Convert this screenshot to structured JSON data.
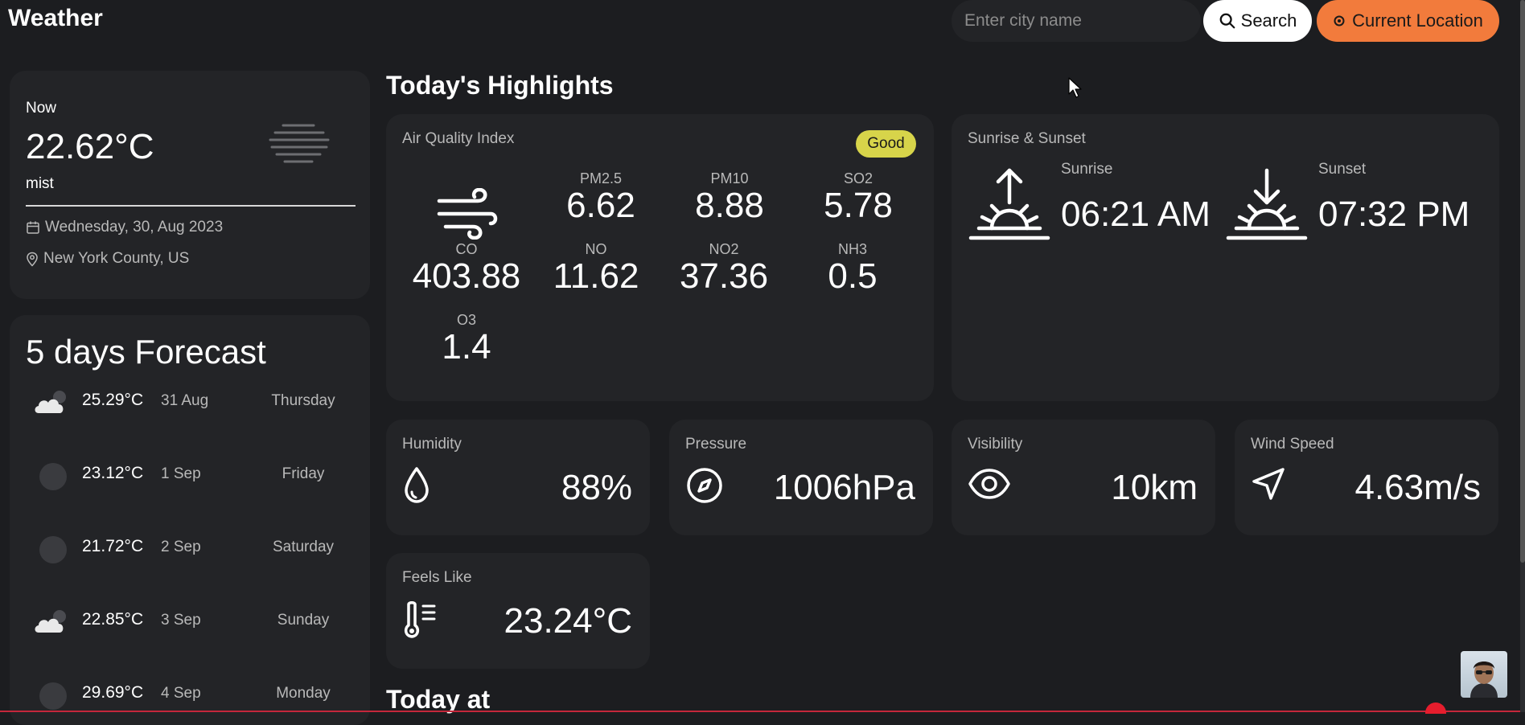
{
  "header": {
    "title": "Weather",
    "search_placeholder": "Enter city name",
    "search_label": "Search",
    "location_label": "Current Location"
  },
  "now": {
    "label": "Now",
    "temperature": "22.62°C",
    "description": "mist",
    "date": "Wednesday, 30, Aug 2023",
    "location": "New York County, US",
    "icon": "mist-icon"
  },
  "forecast": {
    "title": "5 days Forecast",
    "days": [
      {
        "temp": "25.29°C",
        "date": "31 Aug",
        "day": "Thursday",
        "icon": "cloud-icon"
      },
      {
        "temp": "23.12°C",
        "date": "1 Sep",
        "day": "Friday",
        "icon": "circle-icon"
      },
      {
        "temp": "21.72°C",
        "date": "2 Sep",
        "day": "Saturday",
        "icon": "circle-icon"
      },
      {
        "temp": "22.85°C",
        "date": "3 Sep",
        "day": "Sunday",
        "icon": "cloud-icon"
      },
      {
        "temp": "29.69°C",
        "date": "4 Sep",
        "day": "Monday",
        "icon": "circle-icon"
      }
    ]
  },
  "highlights": {
    "title": "Today's Highlights",
    "aqi": {
      "label": "Air Quality Index",
      "badge": "Good",
      "badge_color": "#d7d44a",
      "items": [
        {
          "name": "PM2.5",
          "value": "6.62"
        },
        {
          "name": "PM10",
          "value": "8.88"
        },
        {
          "name": "SO2",
          "value": "5.78"
        },
        {
          "name": "CO",
          "value": "403.88"
        },
        {
          "name": "NO",
          "value": "11.62"
        },
        {
          "name": "NO2",
          "value": "37.36"
        },
        {
          "name": "NH3",
          "value": "0.5"
        },
        {
          "name": "O3",
          "value": "1.4"
        }
      ]
    },
    "sun": {
      "label": "Sunrise & Sunset",
      "sunrise_label": "Sunrise",
      "sunrise_time": "06:21 AM",
      "sunset_label": "Sunset",
      "sunset_time": "07:32 PM"
    },
    "humidity": {
      "label": "Humidity",
      "value": "88%"
    },
    "pressure": {
      "label": "Pressure",
      "value": "1006hPa"
    },
    "visibility": {
      "label": "Visibility",
      "value": "10km"
    },
    "wind": {
      "label": "Wind Speed",
      "value": "4.63m/s"
    },
    "feels_like": {
      "label": "Feels Like",
      "value": "23.24°C"
    }
  },
  "today_at": {
    "title": "Today at"
  },
  "colors": {
    "background": "#1c1d20",
    "card": "#232427",
    "accent": "#f27b3c",
    "badge": "#d7d44a"
  }
}
